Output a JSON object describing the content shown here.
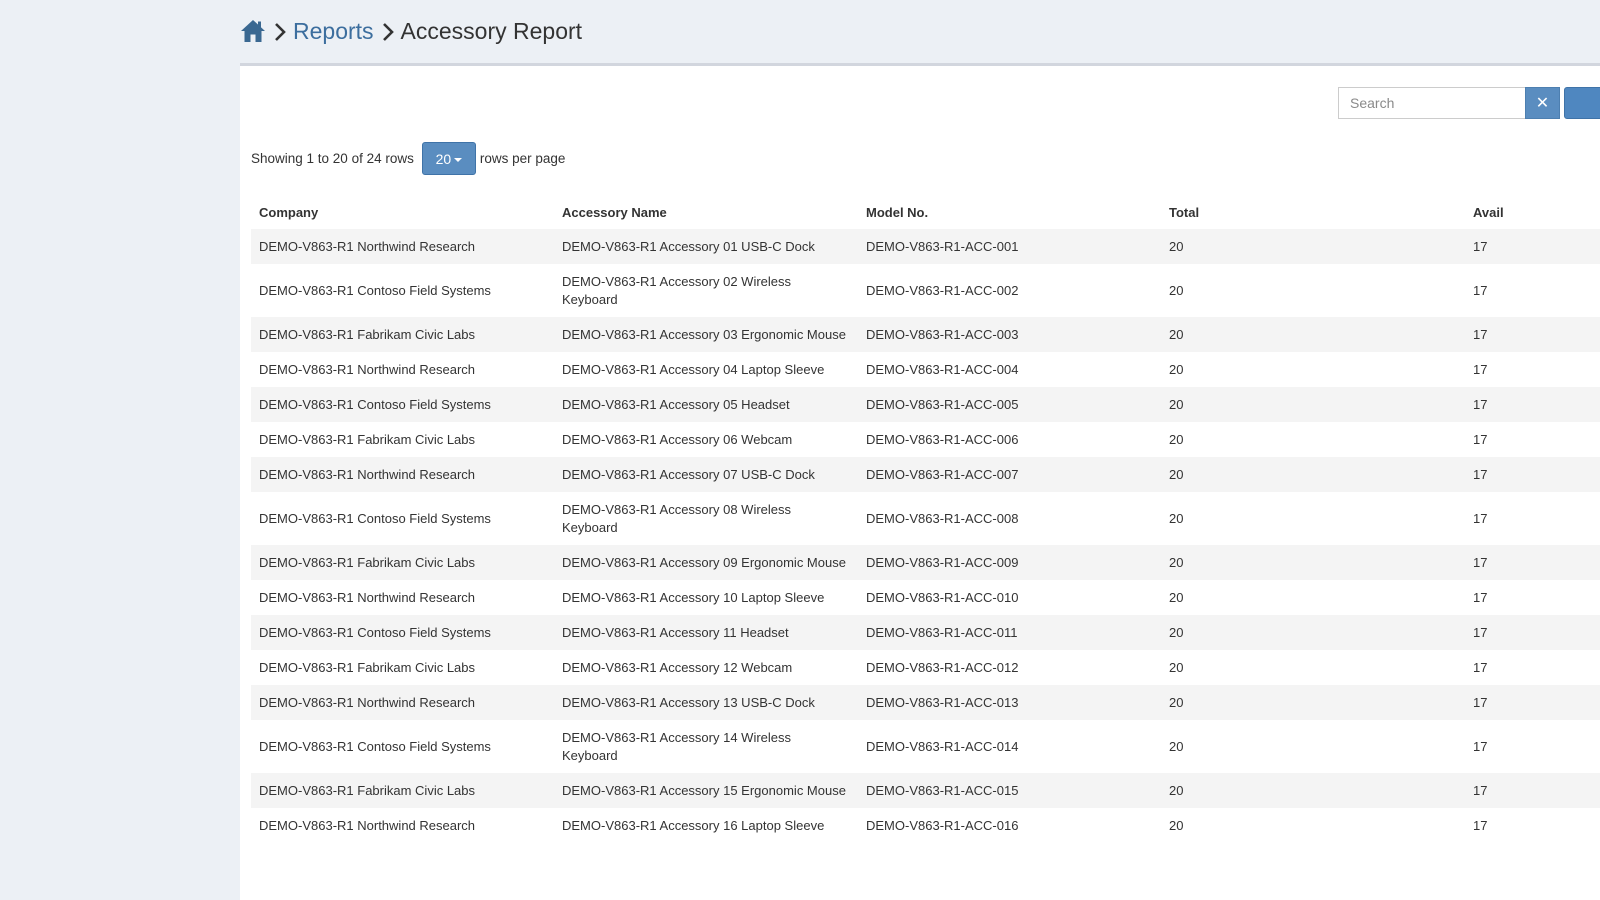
{
  "breadcrumb": {
    "home_icon": "home-icon",
    "reports_label": "Reports",
    "current_label": "Accessory Report"
  },
  "toolbar": {
    "search_placeholder": "Search",
    "clear_label": "✕"
  },
  "pagination": {
    "showing_text": "Showing 1 to 20 of 24 rows",
    "page_size": "20",
    "rows_per_page_text": "rows per page"
  },
  "table": {
    "columns": [
      "Company",
      "Accessory Name",
      "Model No.",
      "Total",
      "Avail"
    ],
    "rows": [
      [
        "DEMO-V863-R1 Northwind Research",
        "DEMO-V863-R1 Accessory 01 USB-C Dock",
        "DEMO-V863-R1-ACC-001",
        "20",
        "17"
      ],
      [
        "DEMO-V863-R1 Contoso Field Systems",
        "DEMO-V863-R1 Accessory 02 Wireless Keyboard",
        "DEMO-V863-R1-ACC-002",
        "20",
        "17"
      ],
      [
        "DEMO-V863-R1 Fabrikam Civic Labs",
        "DEMO-V863-R1 Accessory 03 Ergonomic Mouse",
        "DEMO-V863-R1-ACC-003",
        "20",
        "17"
      ],
      [
        "DEMO-V863-R1 Northwind Research",
        "DEMO-V863-R1 Accessory 04 Laptop Sleeve",
        "DEMO-V863-R1-ACC-004",
        "20",
        "17"
      ],
      [
        "DEMO-V863-R1 Contoso Field Systems",
        "DEMO-V863-R1 Accessory 05 Headset",
        "DEMO-V863-R1-ACC-005",
        "20",
        "17"
      ],
      [
        "DEMO-V863-R1 Fabrikam Civic Labs",
        "DEMO-V863-R1 Accessory 06 Webcam",
        "DEMO-V863-R1-ACC-006",
        "20",
        "17"
      ],
      [
        "DEMO-V863-R1 Northwind Research",
        "DEMO-V863-R1 Accessory 07 USB-C Dock",
        "DEMO-V863-R1-ACC-007",
        "20",
        "17"
      ],
      [
        "DEMO-V863-R1 Contoso Field Systems",
        "DEMO-V863-R1 Accessory 08 Wireless Keyboard",
        "DEMO-V863-R1-ACC-008",
        "20",
        "17"
      ],
      [
        "DEMO-V863-R1 Fabrikam Civic Labs",
        "DEMO-V863-R1 Accessory 09 Ergonomic Mouse",
        "DEMO-V863-R1-ACC-009",
        "20",
        "17"
      ],
      [
        "DEMO-V863-R1 Northwind Research",
        "DEMO-V863-R1 Accessory 10 Laptop Sleeve",
        "DEMO-V863-R1-ACC-010",
        "20",
        "17"
      ],
      [
        "DEMO-V863-R1 Contoso Field Systems",
        "DEMO-V863-R1 Accessory 11 Headset",
        "DEMO-V863-R1-ACC-011",
        "20",
        "17"
      ],
      [
        "DEMO-V863-R1 Fabrikam Civic Labs",
        "DEMO-V863-R1 Accessory 12 Webcam",
        "DEMO-V863-R1-ACC-012",
        "20",
        "17"
      ],
      [
        "DEMO-V863-R1 Northwind Research",
        "DEMO-V863-R1 Accessory 13 USB-C Dock",
        "DEMO-V863-R1-ACC-013",
        "20",
        "17"
      ],
      [
        "DEMO-V863-R1 Contoso Field Systems",
        "DEMO-V863-R1 Accessory 14 Wireless Keyboard",
        "DEMO-V863-R1-ACC-014",
        "20",
        "17"
      ],
      [
        "DEMO-V863-R1 Fabrikam Civic Labs",
        "DEMO-V863-R1 Accessory 15 Ergonomic Mouse",
        "DEMO-V863-R1-ACC-015",
        "20",
        "17"
      ],
      [
        "DEMO-V863-R1 Northwind Research",
        "DEMO-V863-R1 Accessory 16 Laptop Sleeve",
        "DEMO-V863-R1-ACC-016",
        "20",
        "17"
      ]
    ]
  },
  "colors": {
    "accent": "#5a8dc0",
    "link": "#3c6e9e",
    "background": "#ecf0f5"
  }
}
